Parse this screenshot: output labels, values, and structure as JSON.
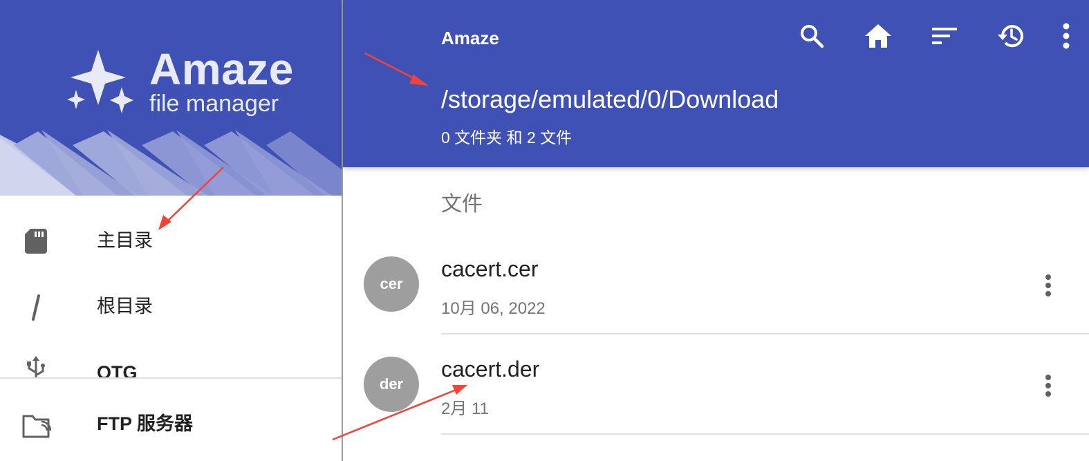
{
  "drawer": {
    "logo": {
      "title": "Amaze",
      "subtitle": "file manager"
    },
    "items": [
      {
        "label": "主目录",
        "icon": "sd-card-icon"
      },
      {
        "label": "根目录",
        "icon": "slash-icon"
      },
      {
        "label": "OTG",
        "icon": "usb-icon"
      },
      {
        "label": "FTP 服务器",
        "icon": "ftp-folder-icon"
      }
    ]
  },
  "appbar": {
    "title": "Amaze",
    "actions": [
      "search-icon",
      "home-icon",
      "sort-icon",
      "history-icon",
      "more-vert-icon"
    ],
    "path": "/storage/emulated/0/Download",
    "count": "0 文件夹 和 2 文件"
  },
  "section": {
    "header": "文件"
  },
  "files": [
    {
      "avatar": "cer",
      "name": "cacert.cer",
      "date": "10月 06, 2022"
    },
    {
      "avatar": "der",
      "name": "cacert.der",
      "date": "2月 11"
    }
  ],
  "colors": {
    "primary": "#3f51b5",
    "avatar": "#9e9e9e",
    "annotation": "#f44336"
  }
}
